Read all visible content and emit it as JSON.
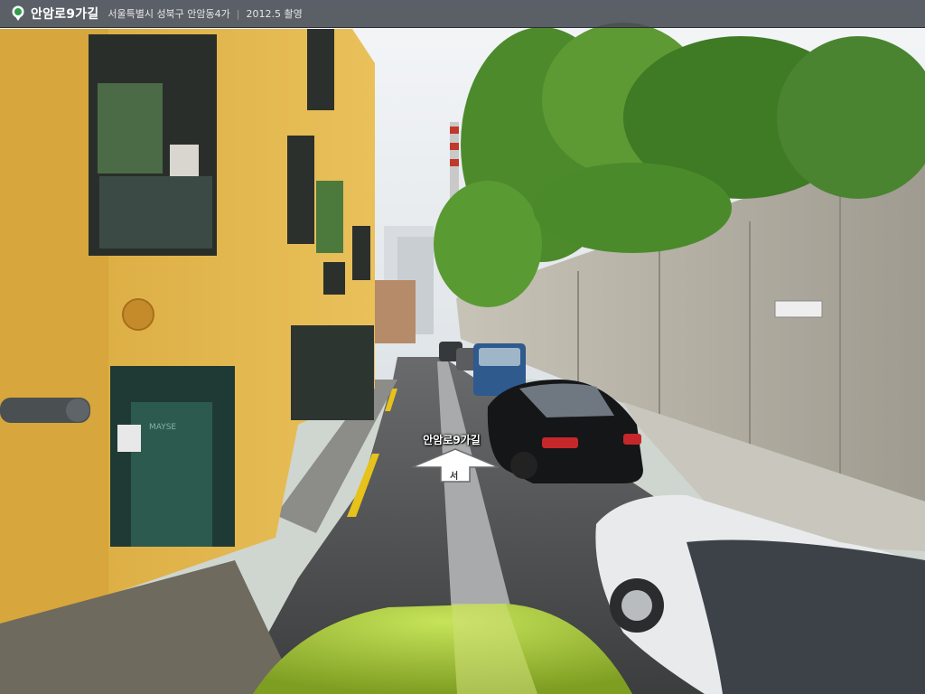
{
  "header": {
    "icon": "map-pin-icon",
    "title": "안암로9가길",
    "address": "서울특별시 성북구 안암동4가",
    "separator": "|",
    "capture_date": "2012.5 촬영"
  },
  "navigation": {
    "street_label": "안암로9가길",
    "direction_glyph": "서",
    "arrow_icon": "forward-arrow-icon"
  },
  "scene": {
    "sign_text": "MAYSE",
    "colors": {
      "building": "#e3b648",
      "sky": "#eef1f4",
      "wall": "#b6b3a8",
      "road": "#4a4b4c",
      "foliage": "#4f8a2e",
      "hood": "#a4c83a",
      "lane_line": "#e6c21a"
    }
  }
}
